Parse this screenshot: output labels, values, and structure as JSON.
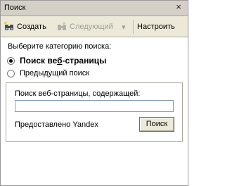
{
  "window": {
    "title": "Поиск",
    "close_glyph": "×"
  },
  "toolbar": {
    "new_label": "Создать",
    "next_label": "Следующий",
    "next_dropdown_glyph": "▾",
    "customize_label": "Настроить"
  },
  "category": {
    "prompt": "Выберите категорию поиска:",
    "options": [
      {
        "label_before": "Поиск ве",
        "hotkey": "б",
        "label_after": "-страницы",
        "selected": true
      },
      {
        "label_before": "Пре",
        "hotkey": "д",
        "label_after": "ыдущий поиск",
        "selected": false
      }
    ]
  },
  "search": {
    "field_label": "Поиск веб-страницы, содержащей:",
    "value": "",
    "placeholder": "",
    "provider_text": "Предоставлено Yandex",
    "button_label": "Поиск"
  },
  "colors": {
    "title_bg": "#d4d0c8",
    "toolbar_bg": "#ece9d8",
    "input_border": "#7f9db9",
    "disabled_text": "#a0a0a0"
  },
  "icons": {
    "new": "binoculars-new-icon",
    "next": "binoculars-next-icon",
    "close": "close-icon"
  }
}
